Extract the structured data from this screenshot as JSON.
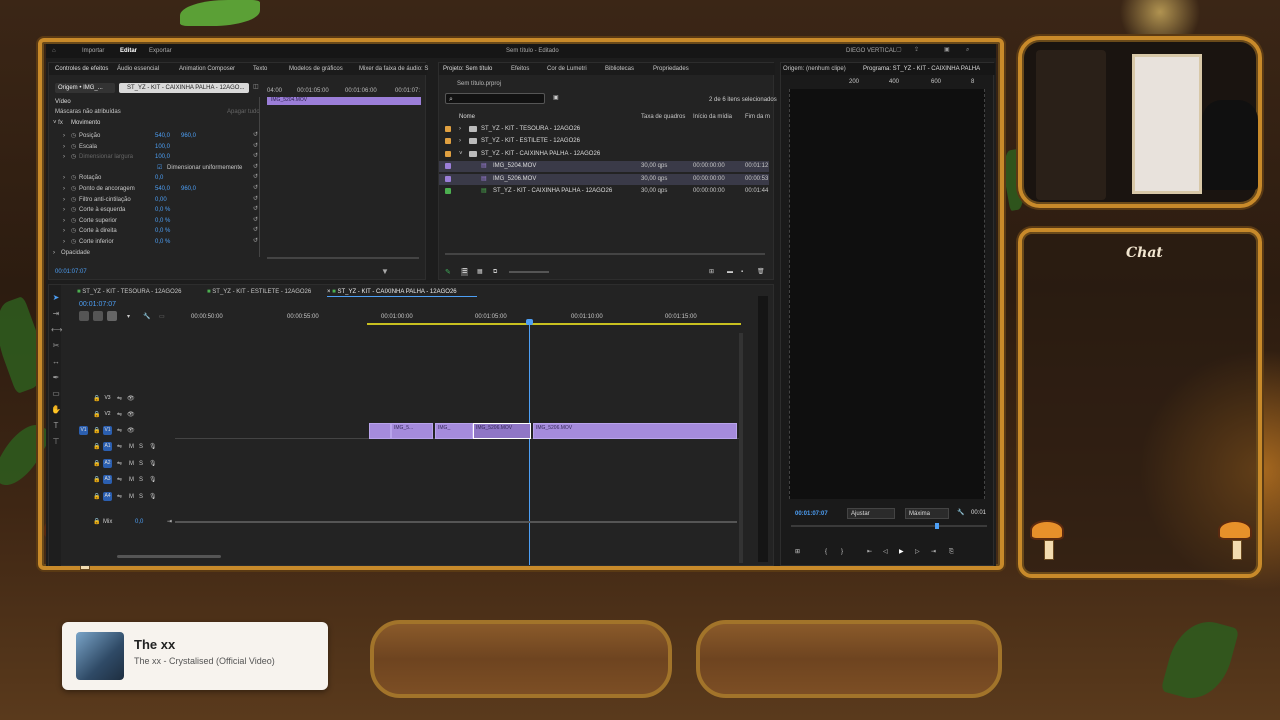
{
  "menubar": {
    "importar": "Importar",
    "editar": "Editar",
    "exportar": "Exportar",
    "title": "Sem título - Editado",
    "workspace": "DIEGO VERTICAL"
  },
  "effects_panel": {
    "tab_controls": "Controles de efeitos",
    "tab_audio": "Áudio essencial",
    "tab_animation": "Animation Composer",
    "tab_text": "Texto",
    "tab_models": "Modelos de gráficos",
    "tab_mixer": "Mixer da faixa de áudio: S",
    "source_label": "Origem • IMG_...",
    "seq_label": "ST_YZ - KIT - CAIXINHA PALHA - 12AGO...",
    "section_video": "Vídeo",
    "masks_label": "Máscaras não atribuídas",
    "clear_all": "Apagar tudo",
    "clip_label": "IMG_5204.MOV",
    "time_00": "04:00",
    "time_01": "00:01:05:00",
    "time_02": "00:01:06:00",
    "time_03": "00:01:07:",
    "movimento": "Movimento",
    "props": [
      {
        "name": "Posição",
        "v1": "540,0",
        "v2": "960,0"
      },
      {
        "name": "Escala",
        "v1": "100,0",
        "v2": ""
      },
      {
        "name": "Dimensionar largura",
        "v1": "100,0",
        "v2": ""
      },
      {
        "name": "Dimensionar uniformemente",
        "v1": "",
        "v2": ""
      },
      {
        "name": "Rotação",
        "v1": "0,0",
        "v2": ""
      },
      {
        "name": "Ponto de ancoragem",
        "v1": "540,0",
        "v2": "960,0"
      },
      {
        "name": "Filtro anti-cintilação",
        "v1": "0,00",
        "v2": ""
      },
      {
        "name": "Corte à esquerda",
        "v1": "0,0 %",
        "v2": ""
      },
      {
        "name": "Corte superior",
        "v1": "0,0 %",
        "v2": ""
      },
      {
        "name": "Corte à direita",
        "v1": "0,0 %",
        "v2": ""
      },
      {
        "name": "Corte inferior",
        "v1": "0,0 %",
        "v2": ""
      }
    ],
    "opacidade": "Opacidade",
    "timecode": "00:01:07:07"
  },
  "project_panel": {
    "tab_project": "Projeto: Sem título",
    "tab_effects": "Efeitos",
    "tab_lumetri": "Cor de Lumetri",
    "tab_libraries": "Bibliotecas",
    "tab_properties": "Propriedades",
    "file": "Sem título.prproj",
    "selected_count": "2 de 6 itens selecionados",
    "col_name": "Nome",
    "col_fps": "Taxa de quadros",
    "col_start": "Início da mídia",
    "col_end": "Fim da m",
    "items": [
      {
        "name": "ST_YZ - KIT - TESOURA - 12AGO26",
        "color": "#e0a040",
        "fps": "",
        "start": "",
        "end": "",
        "kind": "folder",
        "indent": 0
      },
      {
        "name": "ST_YZ - KIT - ESTILETE - 12AGO26",
        "color": "#e0a040",
        "fps": "",
        "start": "",
        "end": "",
        "kind": "folder",
        "indent": 0
      },
      {
        "name": "ST_YZ - KIT - CAIXINHA PALHA - 12AGO26",
        "color": "#e0a040",
        "fps": "",
        "start": "",
        "end": "",
        "kind": "folder",
        "indent": 0
      },
      {
        "name": "IMG_5204.MOV",
        "color": "#9b7ed8",
        "fps": "30,00 qps",
        "start": "00:00:00:00",
        "end": "00:01:12",
        "kind": "clip",
        "indent": 1
      },
      {
        "name": "IMG_5206.MOV",
        "color": "#9b7ed8",
        "fps": "30,00 qps",
        "start": "00:00:00:00",
        "end": "00:00:53",
        "kind": "clip",
        "indent": 1
      },
      {
        "name": "ST_YZ - KIT - CAIXINHA PALHA - 12AGO26",
        "color": "#4caf50",
        "fps": "30,00 qps",
        "start": "00:00:00:00",
        "end": "00:01:44",
        "kind": "seq",
        "indent": 1
      }
    ]
  },
  "program_monitor": {
    "tab_source": "Origem: (nenhum clipe)",
    "tab_program": "Programa: ST_YZ - KIT - CAIXINHA PALHA",
    "ruler": [
      "200",
      "400",
      "600",
      "8"
    ],
    "timecode": "00:01:07:07",
    "fit": "Ajustar",
    "quality": "Máxima",
    "duration": "00:01"
  },
  "timeline": {
    "tabs": [
      "ST_YZ - KIT - TESOURA - 12AGO26",
      "ST_YZ - KIT - ESTILETE - 12AGO26",
      "ST_YZ - KIT - CAIXINHA PALHA - 12AGO26"
    ],
    "timecode": "00:01:07:07",
    "ruler": [
      "00:00:50:00",
      "00:00:55:00",
      "00:01:00:00",
      "00:01:05:00",
      "00:01:10:00",
      "00:01:15:00"
    ],
    "video_tracks": [
      "V3",
      "V2",
      "V1"
    ],
    "audio_tracks": [
      "A1",
      "A2",
      "A3",
      "A4"
    ],
    "mix_label": "Mix",
    "mix_value": "0,0",
    "clips": [
      "IMG_5...",
      "IMG_",
      "IMG_5206.MOV",
      "IMG_5206.MOV"
    ]
  },
  "chat_label": "Chat",
  "now_playing": {
    "title": "The xx",
    "subtitle": "The xx - Crystalised (Official Video)"
  }
}
